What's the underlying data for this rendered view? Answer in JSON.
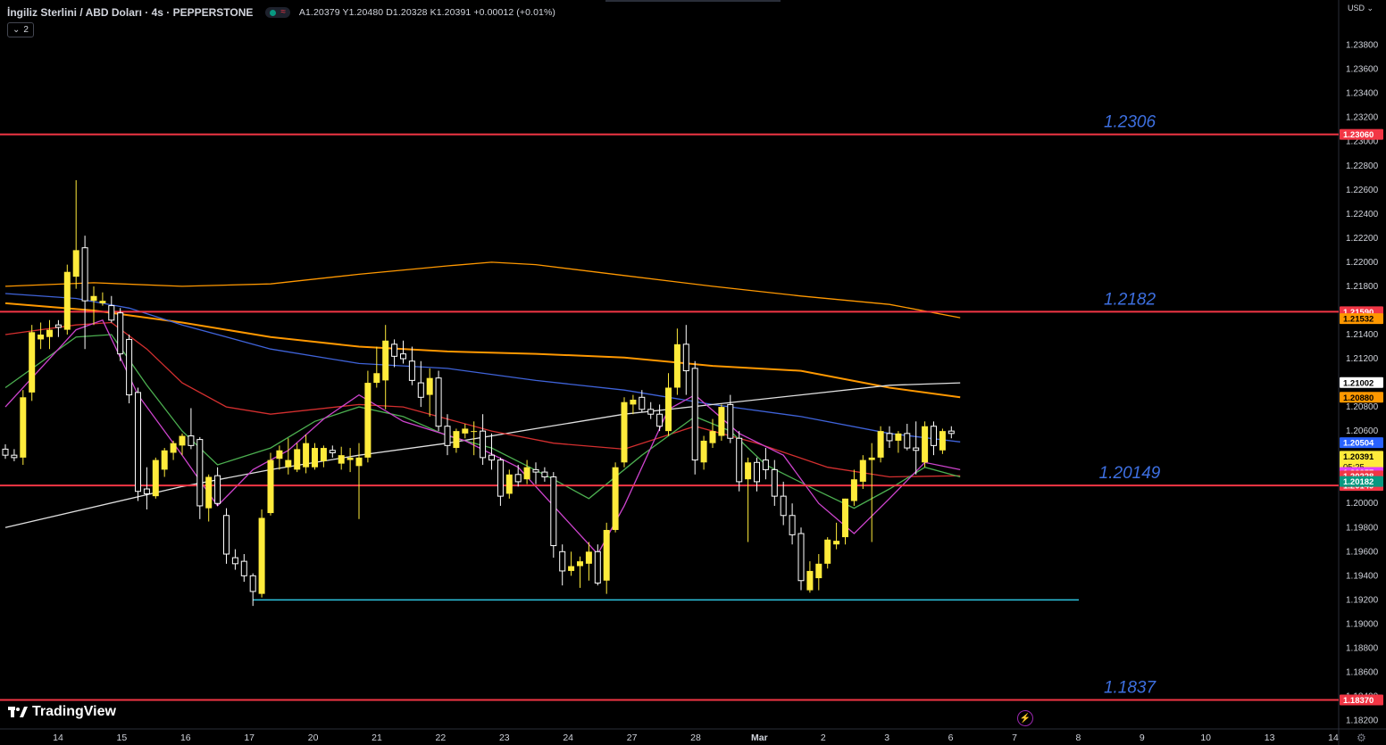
{
  "header": {
    "title": "İngiliz Sterlini / ABD Doları · 4s · PEPPERSTONE",
    "ohlc": "A1.20379 Y1.20480 D1.20328 K1.20391 +0.00012 (+0.01%)",
    "indicator_count": "2"
  },
  "branding": {
    "logo_text": "TradingView"
  },
  "axis": {
    "currency": "USD"
  },
  "chart_data": {
    "type": "candlestick",
    "y_range": [
      1.1813,
      1.2413
    ],
    "y_ticks": [
      "1.23800",
      "1.23600",
      "1.23400",
      "1.23200",
      "1.23000",
      "1.22800",
      "1.22600",
      "1.22400",
      "1.22200",
      "1.22000",
      "1.21800",
      "1.21600",
      "1.21400",
      "1.21200",
      "1.21000",
      "1.20800",
      "1.20600",
      "1.20400",
      "1.20200",
      "1.20000",
      "1.19800",
      "1.19600",
      "1.19400",
      "1.19200",
      "1.19000",
      "1.18800",
      "1.18600",
      "1.18400",
      "1.18200"
    ],
    "x_ticks": [
      "14",
      "15",
      "16",
      "17",
      "20",
      "21",
      "22",
      "23",
      "24",
      "27",
      "28",
      "Mar",
      "2",
      "3",
      "6",
      "7",
      "8",
      "9",
      "10",
      "13",
      "14"
    ],
    "candles": [
      [
        1.2045,
        1.2049,
        1.2037,
        1.204
      ],
      [
        1.204,
        1.2045,
        1.2035,
        1.2038
      ],
      [
        1.2038,
        1.2094,
        1.2032,
        1.2088
      ],
      [
        1.2092,
        1.2148,
        1.2085,
        1.2142
      ],
      [
        1.2136,
        1.215,
        1.2128,
        1.214
      ],
      [
        1.2138,
        1.2152,
        1.2128,
        1.2144
      ],
      [
        1.2148,
        1.2152,
        1.2138,
        1.2146
      ],
      [
        1.2144,
        1.2198,
        1.214,
        1.2192
      ],
      [
        1.2188,
        1.2268,
        1.2178,
        1.221
      ],
      [
        1.2212,
        1.2222,
        1.2128,
        1.2168
      ],
      [
        1.2168,
        1.218,
        1.2148,
        1.2172
      ],
      [
        1.2166,
        1.2175,
        1.2164,
        1.2168
      ],
      [
        1.2164,
        1.2172,
        1.215,
        1.2152
      ],
      [
        1.2158,
        1.2162,
        1.2118,
        1.2124
      ],
      [
        1.2136,
        1.214,
        1.2083,
        1.209
      ],
      [
        1.2092,
        1.2096,
        1.2002,
        1.201
      ],
      [
        1.2012,
        1.203,
        1.1995,
        1.2008
      ],
      [
        1.2006,
        1.2038,
        1.2004,
        1.2036
      ],
      [
        1.2028,
        1.2046,
        1.2022,
        1.2044
      ],
      [
        1.2042,
        1.2052,
        1.2036,
        1.205
      ],
      [
        1.2048,
        1.2058,
        1.204,
        1.2056
      ],
      [
        1.2056,
        1.2079,
        1.2045,
        1.2048
      ],
      [
        1.2053,
        1.2055,
        1.1987,
        1.1998
      ],
      [
        1.1996,
        1.2024,
        1.1985,
        1.2022
      ],
      [
        1.2023,
        1.203,
        1.1998,
        1.2
      ],
      [
        1.199,
        1.1996,
        1.195,
        1.1958
      ],
      [
        1.1955,
        1.1962,
        1.1945,
        1.195
      ],
      [
        1.1952,
        1.1958,
        1.1935,
        1.194
      ],
      [
        1.194,
        1.1942,
        1.1915,
        1.1927
      ],
      [
        1.1925,
        1.1995,
        1.1922,
        1.1988
      ],
      [
        1.1992,
        1.2042,
        1.199,
        1.2036
      ],
      [
        1.2037,
        1.2048,
        1.2028,
        1.2044
      ],
      [
        1.203,
        1.2054,
        1.2024,
        1.2036
      ],
      [
        1.2028,
        1.205,
        1.2026,
        1.2045
      ],
      [
        1.203,
        1.2057,
        1.2025,
        1.205
      ],
      [
        1.203,
        1.205,
        1.2028,
        1.2046
      ],
      [
        1.2035,
        1.2048,
        1.203,
        1.2046
      ],
      [
        1.2044,
        1.2048,
        1.2038,
        1.2042
      ],
      [
        1.2033,
        1.2047,
        1.2028,
        1.204
      ],
      [
        1.2036,
        1.2046,
        1.2026,
        1.2038
      ],
      [
        1.2031,
        1.205,
        1.1987,
        1.2038
      ],
      [
        1.2038,
        1.211,
        1.2034,
        1.21
      ],
      [
        1.21,
        1.213,
        1.2096,
        1.2108
      ],
      [
        1.2102,
        1.2148,
        1.2078,
        1.2135
      ],
      [
        1.2132,
        1.2136,
        1.2113,
        1.2122
      ],
      [
        1.2124,
        1.2135,
        1.2116,
        1.212
      ],
      [
        1.2118,
        1.213,
        1.2098,
        1.2102
      ],
      [
        1.21,
        1.2118,
        1.208,
        1.2088
      ],
      [
        1.209,
        1.2112,
        1.2072,
        1.2104
      ],
      [
        1.2104,
        1.211,
        1.206,
        1.2064
      ],
      [
        1.2064,
        1.2074,
        1.204,
        1.2048
      ],
      [
        1.2046,
        1.2062,
        1.2042,
        1.206
      ],
      [
        1.2058,
        1.2066,
        1.2054,
        1.2062
      ],
      [
        1.206,
        1.2068,
        1.204,
        1.206
      ],
      [
        1.206,
        1.2074,
        1.2032,
        1.2038
      ],
      [
        1.204,
        1.2058,
        1.2028,
        1.2036
      ],
      [
        1.2036,
        1.2038,
        1.1998,
        1.2006
      ],
      [
        1.2008,
        1.2028,
        1.2004,
        1.2024
      ],
      [
        1.2024,
        1.2032,
        1.2014,
        1.2018
      ],
      [
        1.202,
        1.2036,
        1.2016,
        1.203
      ],
      [
        1.2028,
        1.2034,
        1.2016,
        1.2026
      ],
      [
        1.2026,
        1.203,
        1.2018,
        1.2022
      ],
      [
        1.2022,
        1.2026,
        1.1955,
        1.1965
      ],
      [
        1.196,
        1.1966,
        1.1932,
        1.1944
      ],
      [
        1.1944,
        1.196,
        1.194,
        1.1948
      ],
      [
        1.1948,
        1.1956,
        1.193,
        1.1952
      ],
      [
        1.195,
        1.1968,
        1.1936,
        1.196
      ],
      [
        1.196,
        1.1966,
        1.1932,
        1.1934
      ],
      [
        1.1936,
        1.1984,
        1.1925,
        1.1978
      ],
      [
        1.1978,
        1.2034,
        1.1976,
        1.203
      ],
      [
        1.2034,
        1.2088,
        1.203,
        1.2084
      ],
      [
        1.2082,
        1.209,
        1.2074,
        1.2086
      ],
      [
        1.2088,
        1.2094,
        1.2076,
        1.2078
      ],
      [
        1.2078,
        1.2084,
        1.207,
        1.2074
      ],
      [
        1.2074,
        1.2082,
        1.206,
        1.2064
      ],
      [
        1.206,
        1.2108,
        1.2056,
        1.2096
      ],
      [
        1.2096,
        1.2145,
        1.209,
        1.2132
      ],
      [
        1.2132,
        1.2148,
        1.209,
        1.211
      ],
      [
        1.2112,
        1.2118,
        1.2024,
        1.2036
      ],
      [
        1.2034,
        1.2056,
        1.2028,
        1.2052
      ],
      [
        1.205,
        1.207,
        1.2046,
        1.206
      ],
      [
        1.2056,
        1.2082,
        1.2052,
        1.208
      ],
      [
        1.2082,
        1.209,
        1.205,
        1.2054
      ],
      [
        1.2054,
        1.206,
        1.201,
        1.2018
      ],
      [
        1.202,
        1.2038,
        1.1968,
        1.2034
      ],
      [
        1.2034,
        1.2038,
        1.201,
        1.2018
      ],
      [
        1.2036,
        1.2046,
        1.202,
        1.2028
      ],
      [
        1.2028,
        1.2036,
        1.1998,
        1.2006
      ],
      [
        1.2006,
        1.2018,
        1.1982,
        1.199
      ],
      [
        1.199,
        1.2,
        1.1966,
        1.1974
      ],
      [
        1.1975,
        1.198,
        1.1928,
        1.1936
      ],
      [
        1.1928,
        1.1952,
        1.1926,
        1.1944
      ],
      [
        1.1938,
        1.1958,
        1.1928,
        1.195
      ],
      [
        1.195,
        1.1972,
        1.1946,
        1.197
      ],
      [
        1.1966,
        1.1984,
        1.1962,
        1.1969
      ],
      [
        1.1972,
        1.2004,
        1.1966,
        1.2004
      ],
      [
        1.2002,
        1.2028,
        1.1998,
        1.202
      ],
      [
        1.2018,
        1.204,
        1.2012,
        1.2036
      ],
      [
        1.2036,
        1.205,
        1.1968,
        1.2038
      ],
      [
        1.2038,
        1.2064,
        1.2034,
        1.206
      ],
      [
        1.2058,
        1.2064,
        1.2046,
        1.2052
      ],
      [
        1.2052,
        1.206,
        1.2042,
        1.2058
      ],
      [
        1.2058,
        1.2066,
        1.2044,
        1.2046
      ],
      [
        1.2046,
        1.2068,
        1.2024,
        1.2044
      ],
      [
        1.2034,
        1.2068,
        1.203,
        1.2064
      ],
      [
        1.2064,
        1.2068,
        1.204,
        1.2048
      ],
      [
        1.2044,
        1.2062,
        1.2041,
        1.206
      ],
      [
        1.206,
        1.2064,
        1.2054,
        1.2058
      ]
    ],
    "series": [
      {
        "color": "#ff9800",
        "values": [
          [
            0,
            1.218
          ],
          [
            10,
            1.2183
          ],
          [
            20,
            1.218
          ],
          [
            30,
            1.2182
          ],
          [
            40,
            1.219
          ],
          [
            50,
            1.2197
          ],
          [
            55,
            1.22
          ],
          [
            60,
            1.2198
          ],
          [
            70,
            1.2189
          ],
          [
            80,
            1.218
          ],
          [
            90,
            1.2172
          ],
          [
            100,
            1.2165
          ],
          [
            108,
            1.2154
          ]
        ]
      },
      {
        "color": "#ff9800",
        "values": [
          [
            0,
            1.2166
          ],
          [
            10,
            1.216
          ],
          [
            20,
            1.215
          ],
          [
            30,
            1.2138
          ],
          [
            40,
            1.213
          ],
          [
            50,
            1.2126
          ],
          [
            60,
            1.2124
          ],
          [
            70,
            1.2121
          ],
          [
            80,
            1.2114
          ],
          [
            90,
            1.211
          ],
          [
            100,
            1.2096
          ],
          [
            108,
            1.2088
          ]
        ]
      },
      {
        "color": "#3f63d9",
        "values": [
          [
            0,
            1.2174
          ],
          [
            8,
            1.217
          ],
          [
            14,
            1.2162
          ],
          [
            20,
            1.2148
          ],
          [
            30,
            1.2128
          ],
          [
            40,
            1.2116
          ],
          [
            50,
            1.2112
          ],
          [
            60,
            1.2102
          ],
          [
            70,
            1.2094
          ],
          [
            80,
            1.2082
          ],
          [
            90,
            1.2072
          ],
          [
            100,
            1.2058
          ],
          [
            108,
            1.2051
          ]
        ]
      },
      {
        "color": "#e0e0e0",
        "values": [
          [
            0,
            1.198
          ],
          [
            20,
            1.2014
          ],
          [
            30,
            1.2028
          ],
          [
            40,
            1.204
          ],
          [
            50,
            1.205
          ],
          [
            60,
            1.2062
          ],
          [
            70,
            1.2074
          ],
          [
            80,
            1.2082
          ],
          [
            90,
            1.209
          ],
          [
            100,
            1.2098
          ],
          [
            108,
            1.21
          ]
        ]
      },
      {
        "color": "#d32f2f",
        "values": [
          [
            0,
            1.214
          ],
          [
            8,
            1.2148
          ],
          [
            12,
            1.215
          ],
          [
            16,
            1.2128
          ],
          [
            20,
            1.21
          ],
          [
            25,
            1.208
          ],
          [
            30,
            1.2074
          ],
          [
            40,
            1.2082
          ],
          [
            45,
            1.208
          ],
          [
            55,
            1.206
          ],
          [
            62,
            1.205
          ],
          [
            70,
            1.2045
          ],
          [
            78,
            1.2064
          ],
          [
            85,
            1.205
          ],
          [
            93,
            1.203
          ],
          [
            100,
            1.2022
          ],
          [
            108,
            1.2023
          ]
        ]
      },
      {
        "color": "#4caf50",
        "values": [
          [
            0,
            1.2096
          ],
          [
            8,
            1.2138
          ],
          [
            12,
            1.214
          ],
          [
            16,
            1.2098
          ],
          [
            20,
            1.206
          ],
          [
            24,
            1.2032
          ],
          [
            30,
            1.2046
          ],
          [
            35,
            1.2068
          ],
          [
            40,
            1.208
          ],
          [
            45,
            1.2072
          ],
          [
            50,
            1.2056
          ],
          [
            55,
            1.2046
          ],
          [
            62,
            1.202
          ],
          [
            66,
            1.2004
          ],
          [
            72,
            1.204
          ],
          [
            78,
            1.2072
          ],
          [
            82,
            1.206
          ],
          [
            86,
            1.2032
          ],
          [
            92,
            1.201
          ],
          [
            96,
            1.1996
          ],
          [
            100,
            1.2012
          ],
          [
            104,
            1.203
          ],
          [
            108,
            1.2022
          ]
        ]
      },
      {
        "color": "#ce44ce",
        "values": [
          [
            0,
            1.208
          ],
          [
            8,
            1.2144
          ],
          [
            11,
            1.2152
          ],
          [
            15,
            1.209
          ],
          [
            20,
            1.204
          ],
          [
            24,
            1.1998
          ],
          [
            28,
            1.2028
          ],
          [
            32,
            1.2044
          ],
          [
            36,
            1.207
          ],
          [
            40,
            1.209
          ],
          [
            45,
            1.2068
          ],
          [
            52,
            1.2052
          ],
          [
            58,
            1.203
          ],
          [
            63,
            1.199
          ],
          [
            67,
            1.1958
          ],
          [
            70,
            1.1998
          ],
          [
            75,
            1.2078
          ],
          [
            78,
            1.209
          ],
          [
            83,
            1.2058
          ],
          [
            88,
            1.204
          ],
          [
            92,
            1.2
          ],
          [
            96,
            1.1975
          ],
          [
            100,
            1.2004
          ],
          [
            104,
            1.2034
          ],
          [
            108,
            1.2028
          ]
        ]
      }
    ],
    "hlines": [
      {
        "price": 1.2306,
        "label": "1.2306",
        "badge": "1.23060",
        "color": "#f23645"
      },
      {
        "price": 1.2159,
        "label": "1.2182",
        "badge": "1.21590",
        "color": "#f23645"
      },
      {
        "price": 1.20149,
        "label": "1.20149",
        "badge": "1.20149",
        "color": "#f23645"
      },
      {
        "price": 1.1837,
        "label": "1.1837",
        "badge": "1.18370",
        "color": "#f23645"
      }
    ],
    "support_line": {
      "price": 1.192,
      "from_index": 39,
      "to_index": 149,
      "color": "#2ec4e0"
    },
    "price_badges": [
      {
        "price": 1.21532,
        "text": "1.21532",
        "bg": "#ff9800",
        "fg": "#000000"
      },
      {
        "price": 1.21002,
        "text": "1.21002",
        "bg": "#ffffff",
        "fg": "#000000"
      },
      {
        "price": 1.2088,
        "text": "1.20880",
        "bg": "#ff9800",
        "fg": "#000000"
      },
      {
        "price": 1.20504,
        "text": "1.20504",
        "bg": "#2962ff",
        "fg": "#ffffff"
      },
      {
        "price": 1.20391,
        "text": "1.20391",
        "sub": "05:25",
        "bg": "#ffeb3b",
        "fg": "#000000"
      },
      {
        "price": 1.20257,
        "text": "1.20257",
        "bg": "#e040fb",
        "fg": "#ffffff"
      },
      {
        "price": 1.20228,
        "text": "1.20228",
        "bg": "#f23645",
        "fg": "#ffffff"
      },
      {
        "price": 1.20182,
        "text": "1.20182",
        "bg": "#089981",
        "fg": "#ffffff"
      }
    ]
  }
}
